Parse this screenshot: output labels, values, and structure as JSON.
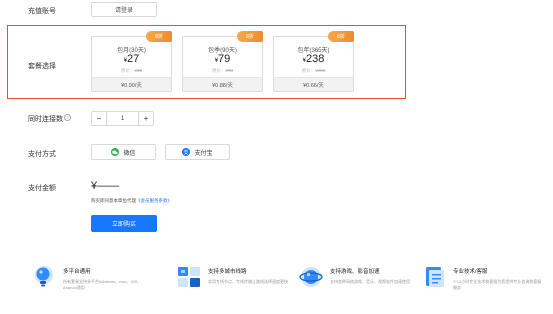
{
  "account": {
    "label": "充值账号",
    "login_button": "请登录"
  },
  "plans": {
    "label": "套餐选择",
    "items": [
      {
        "badge": "8折",
        "name": "包月(30天)",
        "currency": "¥",
        "price": "27",
        "orig_prefix": "原价：",
        "orig_price": "¥30",
        "daily": "¥0.90/天"
      },
      {
        "badge": "8折",
        "name": "包季(90天)",
        "currency": "¥",
        "price": "79",
        "orig_prefix": "原价：",
        "orig_price": "¥88",
        "daily": "¥0.88/天"
      },
      {
        "badge": "8折",
        "name": "包年(365天)",
        "currency": "¥",
        "price": "238",
        "orig_prefix": "原价：",
        "orig_price": "¥298",
        "daily": "¥0.66/天"
      }
    ]
  },
  "connections": {
    "label": "同时连接数",
    "help": "?",
    "minus": "−",
    "value": "1",
    "plus": "+"
  },
  "payment": {
    "label": "支付方式",
    "methods": [
      {
        "name": "微信",
        "icon": "wechat-icon",
        "color": "#2bb24c"
      },
      {
        "name": "支付宝",
        "icon": "alipay-icon",
        "color": "#1677ff"
      }
    ]
  },
  "amount": {
    "label": "支付金额",
    "value": "¥——",
    "notice_prefix": "购买即同意本章鱼代理",
    "notice_link": "《会员服务条款》",
    "buy_button": "立即购买"
  },
  "features": [
    {
      "title": "多平台通用",
      "desc": "所有套餐支持多平台Windows、mac、iOS、Android通用",
      "icon": "lightbulb-icon"
    },
    {
      "title": "支持多城市线路",
      "desc": "实用专线节点，专线传输让路线选择速度更快",
      "icon": "city-grid-icon"
    },
    {
      "title": "支持游戏、影音加速",
      "desc": "支持各种网络游戏、音乐、视频软件加速使用",
      "icon": "globe-icon"
    },
    {
      "title": "专业技术/客服",
      "desc": "7*12小时专业技术和客服为您提供专业咨询和客服服务",
      "icon": "document-icon"
    }
  ],
  "colors": {
    "accent": "#1677ff",
    "highlight": "#e74c3c",
    "badge": "#f08a2b"
  }
}
